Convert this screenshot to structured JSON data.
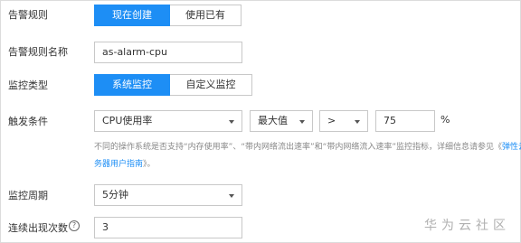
{
  "alarm_rule": {
    "label": "告警规则",
    "options": [
      "现在创建",
      "使用已有"
    ],
    "selected": "现在创建"
  },
  "rule_name": {
    "label": "告警规则名称",
    "value": "as-alarm-cpu"
  },
  "monitor_type": {
    "label": "监控类型",
    "options": [
      "系统监控",
      "自定义监控"
    ],
    "selected": "系统监控"
  },
  "trigger": {
    "label": "触发条件",
    "metric": "CPU使用率",
    "aggregation": "最大值",
    "operator": ">",
    "threshold": "75",
    "unit": "%",
    "hint_line1": "不同的操作系统是否支持“内存使用率”、“带内网络流出速率”和“带内网络流入速率”监控指标，详细信息请参见《",
    "hint_link_a": "弹性云服",
    "hint_link_b": "务器用户指南",
    "hint_end": "》。"
  },
  "period": {
    "label": "监控周期",
    "value": "5分钟"
  },
  "consecutive": {
    "label": "连续出现次数",
    "help_icon": "question-circle-icon",
    "value": "3"
  },
  "watermark": "华为云社区"
}
